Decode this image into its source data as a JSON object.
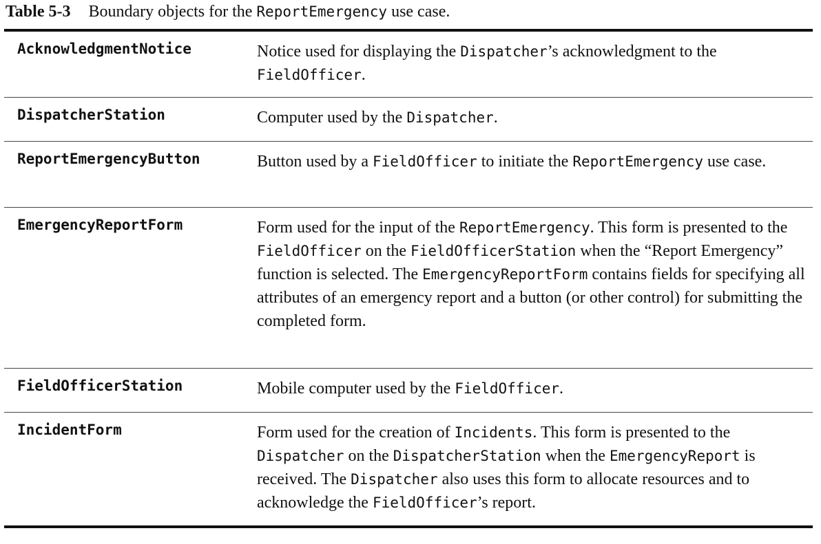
{
  "caption": {
    "number": "Table 5-3",
    "text_before": "Boundary objects for the ",
    "code": "ReportEmergency",
    "text_after": " use case."
  },
  "rows": [
    {
      "term": "AcknowledgmentNotice",
      "desc": [
        {
          "t": "Notice used for displaying the "
        },
        {
          "c": "Dispatcher"
        },
        {
          "t": "’s acknowledgment to the "
        },
        {
          "c": "FieldOfficer"
        },
        {
          "t": "."
        }
      ]
    },
    {
      "term": "DispatcherStation",
      "desc": [
        {
          "t": "Computer used by the "
        },
        {
          "c": "Dispatcher"
        },
        {
          "t": "."
        }
      ]
    },
    {
      "term": "ReportEmergencyButton",
      "desc": [
        {
          "t": "Button used by a "
        },
        {
          "c": "FieldOfficer"
        },
        {
          "t": " to initiate the "
        },
        {
          "c": "ReportEmergency"
        },
        {
          "t": " use case."
        }
      ]
    },
    {
      "term": "EmergencyReportForm",
      "desc": [
        {
          "t": "Form used for the input of the "
        },
        {
          "c": "ReportEmergency"
        },
        {
          "t": ". This form is presented to the "
        },
        {
          "c": "FieldOfficer"
        },
        {
          "t": " on the "
        },
        {
          "c": "FieldOfficerStation"
        },
        {
          "t": " when the “Report Emergency” function is selected. The "
        },
        {
          "c": "EmergencyReportForm"
        },
        {
          "t": " contains fields for specifying all attributes of an emergency report and a button (or other control) for submitting the completed form."
        }
      ]
    },
    {
      "term": "FieldOfficerStation",
      "desc": [
        {
          "t": "Mobile computer used by the "
        },
        {
          "c": "FieldOfficer"
        },
        {
          "t": "."
        }
      ]
    },
    {
      "term": "IncidentForm",
      "desc": [
        {
          "t": "Form used for the creation of "
        },
        {
          "c": "Incidents"
        },
        {
          "t": ". This form is presented to the "
        },
        {
          "c": "Dispatcher"
        },
        {
          "t": " on the "
        },
        {
          "c": "DispatcherStation"
        },
        {
          "t": " when the "
        },
        {
          "c": "EmergencyReport"
        },
        {
          "t": " is received. The "
        },
        {
          "c": "Dispatcher"
        },
        {
          "t": " also uses this form to allocate resources and to acknowledge the "
        },
        {
          "c": "FieldOfficer"
        },
        {
          "t": "’s report."
        }
      ]
    }
  ]
}
